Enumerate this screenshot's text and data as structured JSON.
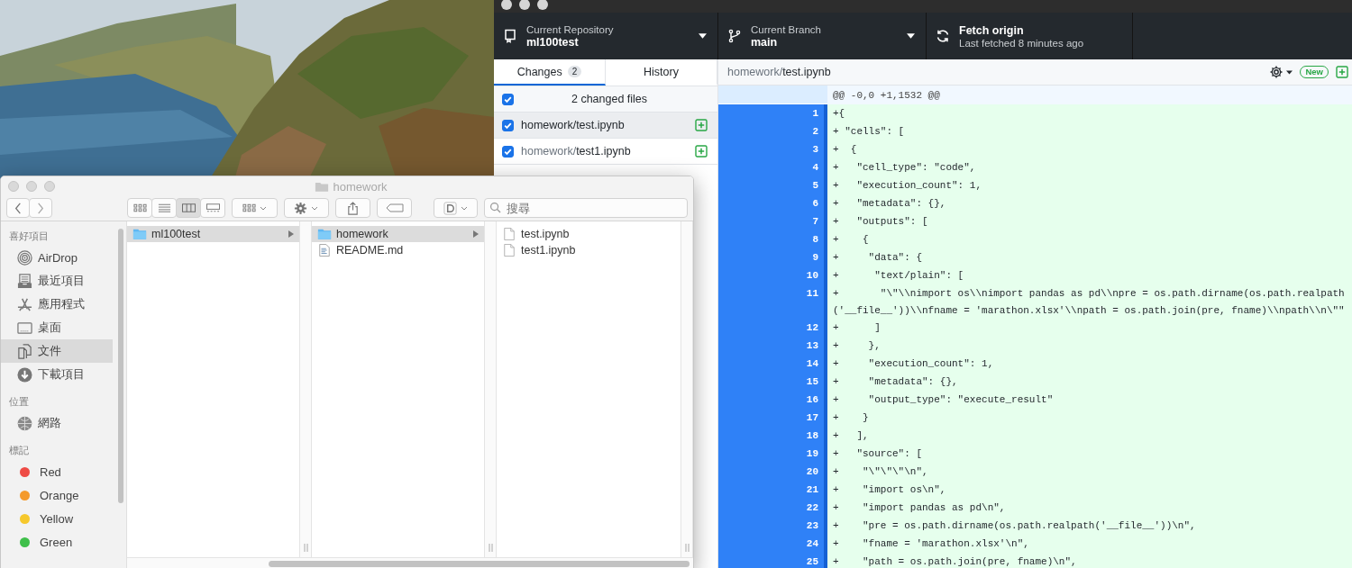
{
  "github": {
    "repository": {
      "label": "Current Repository",
      "value": "ml100test"
    },
    "branch": {
      "label": "Current Branch",
      "value": "main"
    },
    "fetch": {
      "title": "Fetch origin",
      "subtitle": "Last fetched 8 minutes ago"
    },
    "tabs": [
      {
        "label": "Changes",
        "count": "2",
        "selected": true
      },
      {
        "label": "History",
        "selected": false
      }
    ],
    "changes": {
      "header": "2 changed files",
      "checked": true,
      "files": [
        {
          "dir": "homework/",
          "name": "test.ipynb",
          "checked": true,
          "selected": true
        },
        {
          "dir": "homework/",
          "name": "test1.ipynb",
          "checked": true,
          "selected": false
        }
      ]
    },
    "diff": {
      "dir": "homework/",
      "name": "test.ipynb",
      "badge": "New",
      "hunk": "@@ -0,0 +1,1532 @@",
      "lines": [
        {
          "num": "1",
          "text": "+{"
        },
        {
          "num": "2",
          "text": "+ \"cells\": ["
        },
        {
          "num": "3",
          "text": "+  {"
        },
        {
          "num": "4",
          "text": "+   \"cell_type\": \"code\","
        },
        {
          "num": "5",
          "text": "+   \"execution_count\": 1,"
        },
        {
          "num": "6",
          "text": "+   \"metadata\": {},"
        },
        {
          "num": "7",
          "text": "+   \"outputs\": ["
        },
        {
          "num": "8",
          "text": "+    {"
        },
        {
          "num": "9",
          "text": "+     \"data\": {"
        },
        {
          "num": "10",
          "text": "+      \"text/plain\": ["
        },
        {
          "num": "11",
          "text": "+       \"\\\"\\\\nimport os\\\\nimport pandas as pd\\\\npre = os.path.dirname(os.path.realpath('__file__'))\\\\nfname = 'marathon.xlsx'\\\\npath = os.path.join(pre, fname)\\\\npath\\\\n\\\"\""
        },
        {
          "num": "12",
          "text": "+      ]"
        },
        {
          "num": "13",
          "text": "+     },"
        },
        {
          "num": "14",
          "text": "+     \"execution_count\": 1,"
        },
        {
          "num": "15",
          "text": "+     \"metadata\": {},"
        },
        {
          "num": "16",
          "text": "+     \"output_type\": \"execute_result\""
        },
        {
          "num": "17",
          "text": "+    }"
        },
        {
          "num": "18",
          "text": "+   ],"
        },
        {
          "num": "19",
          "text": "+   \"source\": ["
        },
        {
          "num": "20",
          "text": "+    \"\\\"\\\"\\\"\\n\","
        },
        {
          "num": "21",
          "text": "+    \"import os\\n\","
        },
        {
          "num": "22",
          "text": "+    \"import pandas as pd\\n\","
        },
        {
          "num": "23",
          "text": "+    \"pre = os.path.dirname(os.path.realpath('__file__'))\\n\","
        },
        {
          "num": "24",
          "text": "+    \"fname = 'marathon.xlsx'\\n\","
        },
        {
          "num": "25",
          "text": "+    \"path = os.path.join(pre, fname)\\n\","
        }
      ]
    }
  },
  "finder": {
    "title": "homework",
    "search": {
      "placeholder": "搜尋"
    },
    "views": [
      {
        "kind": "icons",
        "selected": false
      },
      {
        "kind": "list",
        "selected": false
      },
      {
        "kind": "columns",
        "selected": true
      },
      {
        "kind": "gallery",
        "selected": false
      }
    ],
    "sidebar": [
      {
        "heading": "喜好項目",
        "items": [
          {
            "label": "AirDrop",
            "kind": "airdrop",
            "selected": false
          },
          {
            "label": "最近項目",
            "kind": "recents",
            "selected": false
          },
          {
            "label": "應用程式",
            "kind": "apps",
            "selected": false
          },
          {
            "label": "桌面",
            "kind": "desktop",
            "selected": false
          },
          {
            "label": "文件",
            "kind": "documents",
            "selected": true
          },
          {
            "label": "下載項目",
            "kind": "downloads",
            "selected": false
          }
        ]
      },
      {
        "heading": "位置",
        "items": [
          {
            "label": "網路",
            "kind": "network",
            "selected": false
          }
        ]
      },
      {
        "heading": "標記",
        "items": [
          {
            "label": "Red",
            "kind": "tag",
            "color": "#ee4b45",
            "selected": false
          },
          {
            "label": "Orange",
            "kind": "tag",
            "color": "#f49a2c",
            "selected": false
          },
          {
            "label": "Yellow",
            "kind": "tag",
            "color": "#f6c82c",
            "selected": false
          },
          {
            "label": "Green",
            "kind": "tag",
            "color": "#3fbf4a",
            "selected": false
          }
        ]
      }
    ],
    "columns": [
      {
        "items": [
          {
            "name": "ml100test",
            "kind": "folder",
            "selected": true
          }
        ]
      },
      {
        "items": [
          {
            "name": "homework",
            "kind": "folder",
            "selected": true
          },
          {
            "name": "README.md",
            "kind": "text",
            "selected": false
          }
        ]
      },
      {
        "items": [
          {
            "name": "test.ipynb",
            "kind": "file",
            "selected": false
          },
          {
            "name": "test1.ipynb",
            "kind": "file",
            "selected": false
          }
        ]
      }
    ]
  }
}
